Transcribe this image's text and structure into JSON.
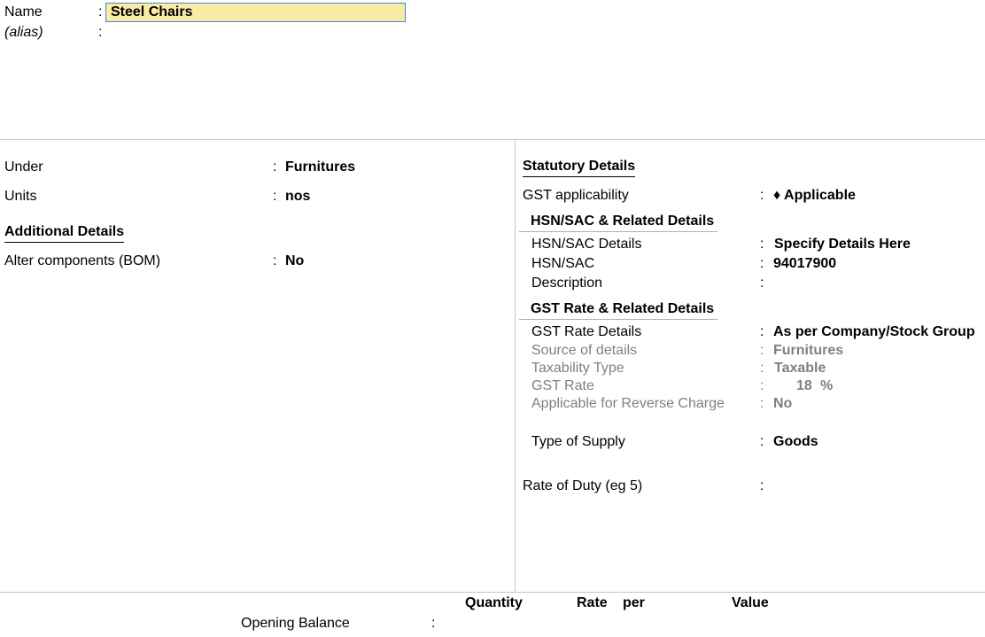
{
  "header": {
    "name_label": "Name",
    "name_value": "Steel Chairs",
    "alias_label": "(alias)",
    "colon": ":"
  },
  "left": {
    "under_label": "Under",
    "under_value": "Furnitures",
    "units_label": "Units",
    "units_value": "nos",
    "additional_heading": "Additional Details",
    "bom_label": "Alter components (BOM)",
    "bom_value": "No"
  },
  "right": {
    "statutory_heading": "Statutory Details",
    "gst_applicability_label": "GST applicability",
    "gst_applicability_value": "♦ Applicable",
    "hsn_heading": "HSN/SAC & Related Details",
    "hsn_details_label": "HSN/SAC Details",
    "hsn_details_value": "Specify Details Here",
    "hsn_label": "HSN/SAC",
    "hsn_value": "94017900",
    "description_label": "Description",
    "gst_rate_heading": "GST Rate & Related Details",
    "gst_rate_details_label": "GST Rate Details",
    "gst_rate_details_value": "As per Company/Stock Group",
    "source_label": "Source of details",
    "source_value": "Furnitures",
    "taxability_label": "Taxability Type",
    "taxability_value": "Taxable",
    "gst_rate_label": "GST Rate",
    "gst_rate_value": "18",
    "gst_rate_unit": "%",
    "reverse_label": "Applicable for Reverse Charge",
    "reverse_value": "No",
    "supply_label": "Type of Supply",
    "supply_value": "Goods",
    "duty_label": "Rate of Duty (eg 5)"
  },
  "footer": {
    "quantity_header": "Quantity",
    "rate_header": "Rate",
    "per_header": "per",
    "value_header": "Value",
    "opening_label": "Opening Balance"
  }
}
